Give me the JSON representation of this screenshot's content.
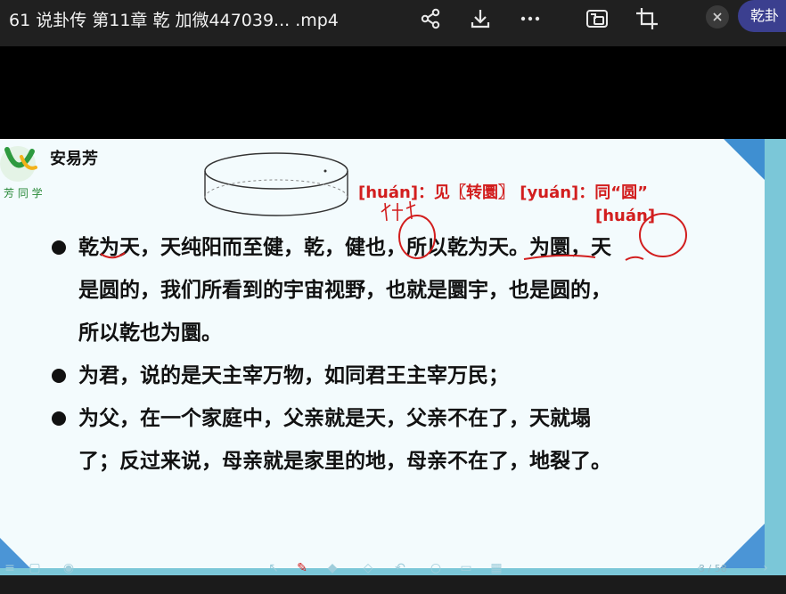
{
  "window": {
    "title": "61 说卦传 第11章 乾 加微447039... .mp4",
    "tab_label": "乾卦"
  },
  "toolbar_icons": [
    "share-icon",
    "download-icon",
    "more-icon",
    "picture-in-picture-icon",
    "crop-icon",
    "close-icon"
  ],
  "slide": {
    "author": "安易芳",
    "logo_text": "芳 同 学",
    "annotation": {
      "line1": "[huán]：见〖转圜〗 [yuán]：同“圆”",
      "line2": "[huán]"
    },
    "bullets": [
      {
        "lines": [
          "乾为天，天纯阳而至健，乾，健也，所以乾为天。为圜，天",
          "是圆的，我们所看到的宇宙视野，也就是圜宇，也是圆的，",
          "所以乾也为圜。"
        ]
      },
      {
        "lines": [
          "为君，说的是天主宰万物，如同君王主宰万民；"
        ]
      },
      {
        "lines": [
          "为父，在一个家庭中，父亲就是天，父亲不在了，天就塌",
          "了；反过来说，母亲就是家里的地，母亲不在了，地裂了。"
        ]
      }
    ],
    "page_indicator": "3 / 58"
  },
  "colors": {
    "accent_blue": "#3f8fd1",
    "annotation_red": "#d21e1e",
    "slide_border": "#7bc7d8"
  }
}
